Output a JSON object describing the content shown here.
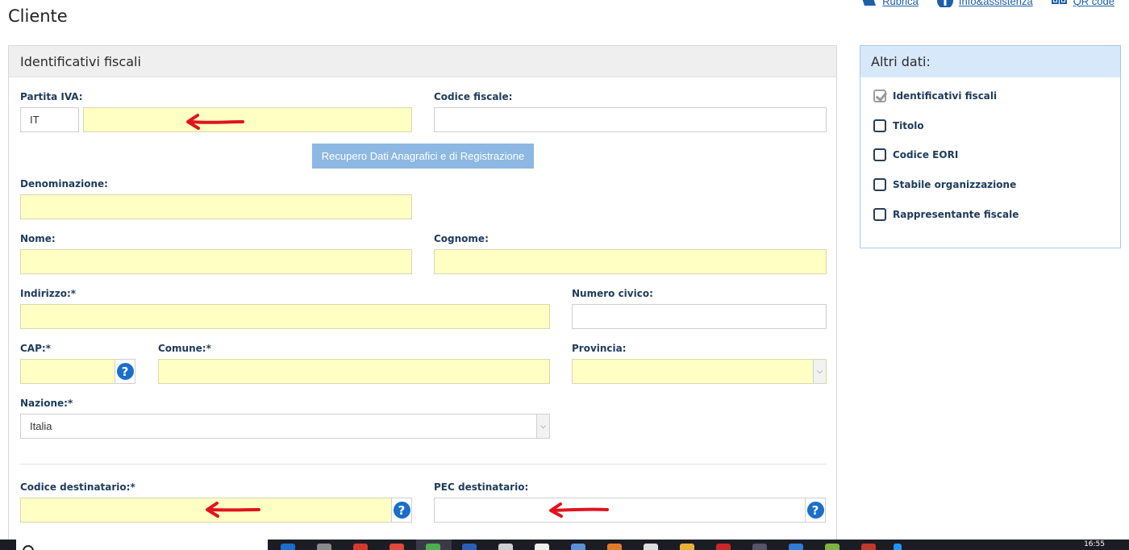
{
  "page": {
    "title": "Cliente"
  },
  "toplinks": [
    {
      "label": "Rubrica",
      "icon": "book-icon"
    },
    {
      "label": "Info&assistenza",
      "icon": "info-icon"
    },
    {
      "label": "QR code",
      "icon": "qr-icon"
    }
  ],
  "panel": {
    "title": "Identificativi fiscali",
    "partita_iva": {
      "label": "Partita IVA:",
      "country": "IT",
      "value": ""
    },
    "codice_fiscale": {
      "label": "Codice fiscale:",
      "value": ""
    },
    "recupero_button": "Recupero Dati Anagrafici e di Registrazione",
    "denominazione": {
      "label": "Denominazione:",
      "value": ""
    },
    "nome": {
      "label": "Nome:",
      "value": ""
    },
    "cognome": {
      "label": "Cognome:",
      "value": ""
    },
    "indirizzo": {
      "label": "Indirizzo:*",
      "value": ""
    },
    "numero_civico": {
      "label": "Numero civico:",
      "value": ""
    },
    "cap": {
      "label": "CAP:*",
      "value": ""
    },
    "comune": {
      "label": "Comune:*",
      "value": ""
    },
    "provincia": {
      "label": "Provincia:",
      "value": ""
    },
    "nazione": {
      "label": "Nazione:*",
      "value": "Italia"
    },
    "codice_destinatario": {
      "label": "Codice destinatario:*",
      "value": ""
    },
    "pec_destinatario": {
      "label": "PEC destinatario:",
      "value": ""
    }
  },
  "side": {
    "title": "Altri dati:",
    "items": [
      {
        "label": "Identificativi fiscali",
        "checked": true
      },
      {
        "label": "Titolo",
        "checked": false
      },
      {
        "label": "Codice EORI",
        "checked": false
      },
      {
        "label": "Stabile organizzazione",
        "checked": false
      },
      {
        "label": "Rappresentante fiscale",
        "checked": false
      }
    ]
  },
  "taskbar": {
    "clock": "16:55"
  },
  "colors": {
    "required_field": "#ffffc4",
    "accent": "#1a6fc9",
    "button": "#8cb8e2",
    "annotation_arrow": "#e0141e"
  }
}
